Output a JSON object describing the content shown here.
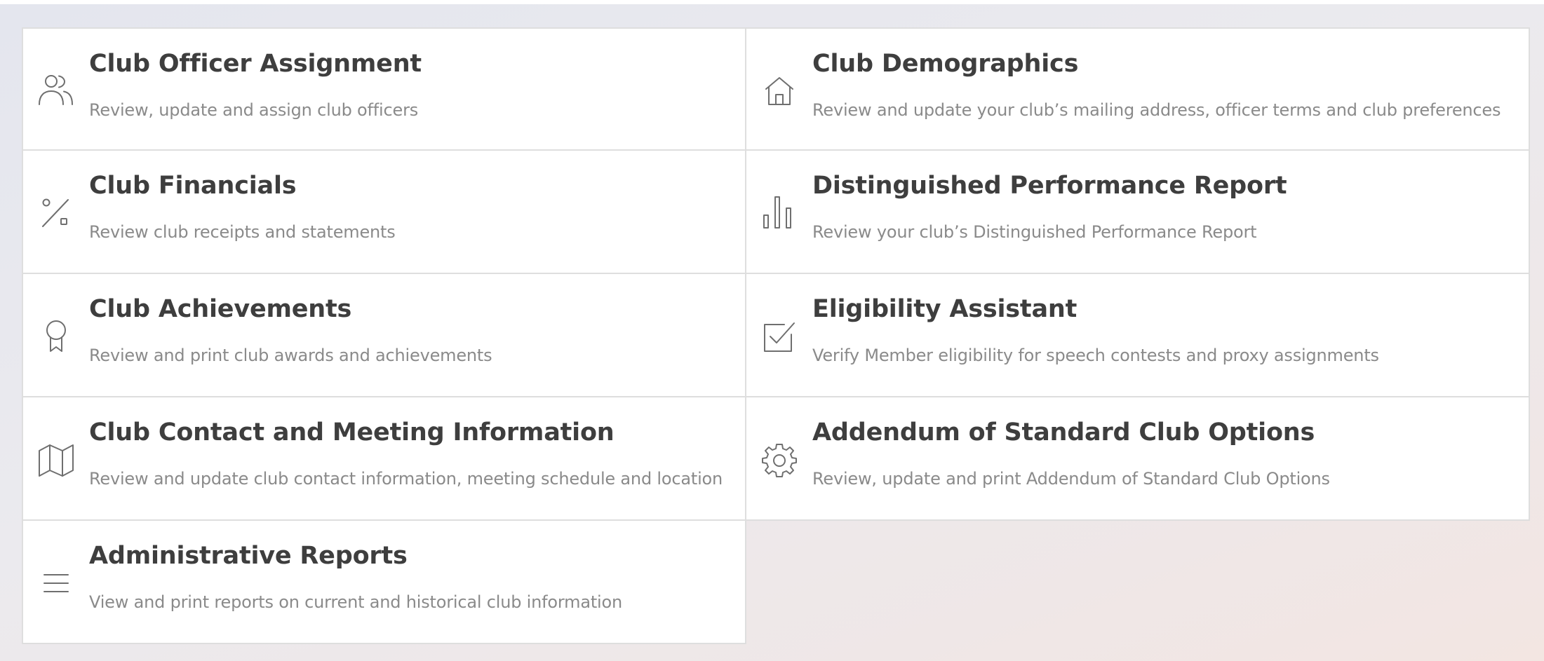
{
  "cards": [
    {
      "title": "Club Officer Assignment",
      "description": "Review, update and assign club officers",
      "icon": "users-icon"
    },
    {
      "title": "Club Demographics",
      "description": "Review and update your club’s mailing address, officer terms and club preferences",
      "icon": "home-icon"
    },
    {
      "title": "Club Financials",
      "description": "Review club receipts and statements",
      "icon": "percent-icon"
    },
    {
      "title": "Distinguished Performance Report",
      "description": "Review your club’s Distinguished Performance Report",
      "icon": "bar-chart-icon"
    },
    {
      "title": "Club Achievements",
      "description": "Review and print club awards and achievements",
      "icon": "award-icon"
    },
    {
      "title": "Eligibility Assistant",
      "description": "Verify Member eligibility for speech contests and proxy assignments",
      "icon": "checkbox-icon"
    },
    {
      "title": "Club Contact and Meeting Information",
      "description": "Review and update club contact information, meeting schedule and location",
      "icon": "map-icon"
    },
    {
      "title": "Addendum of Standard Club Options",
      "description": "Review, update and print Addendum of Standard Club Options",
      "icon": "gear-icon"
    },
    {
      "title": "Administrative Reports",
      "description": "View and print reports on current and historical club information",
      "icon": "menu-icon"
    }
  ],
  "colors": {
    "icon": "#6f6f6f",
    "title": "#3e3e3e",
    "description": "#8a8a8a",
    "border": "#dedede"
  }
}
